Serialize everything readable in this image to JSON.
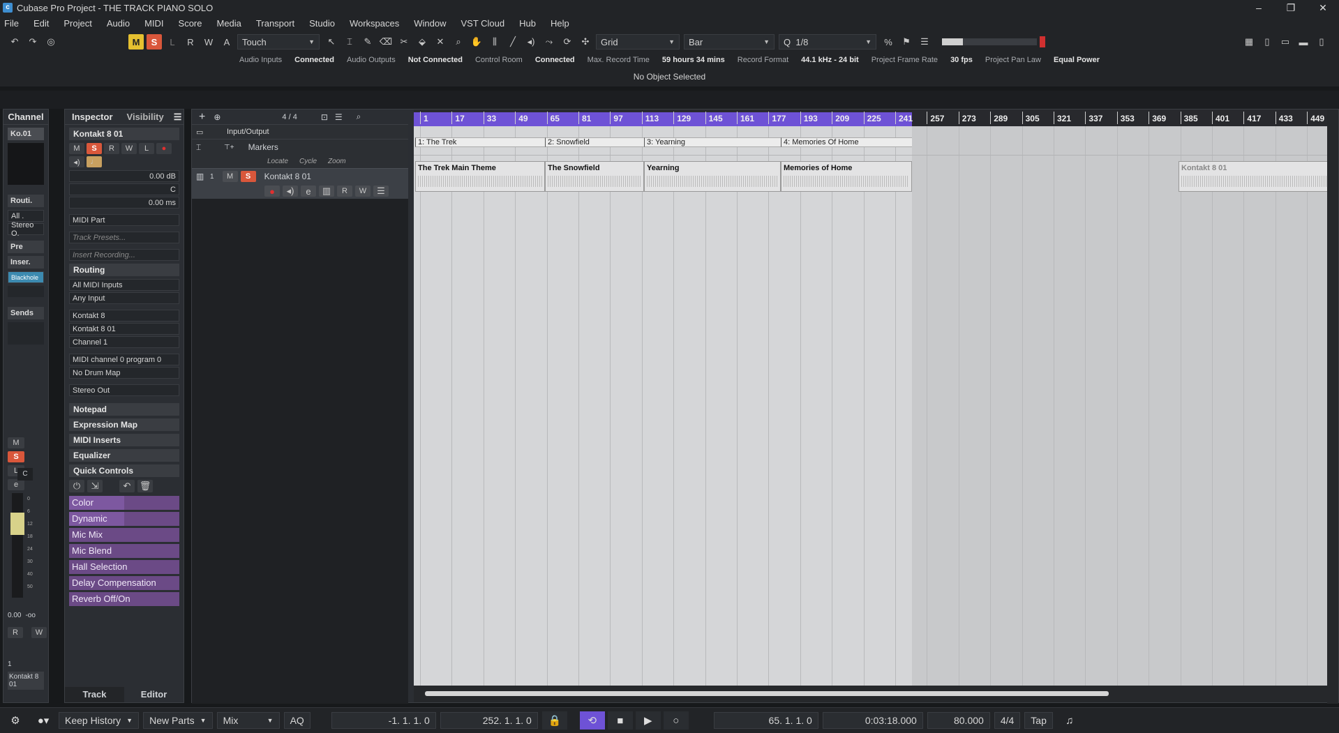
{
  "window": {
    "title": "Cubase Pro Project - THE TRACK PIANO SOLO",
    "controls": [
      "–",
      "❐",
      "✕"
    ]
  },
  "menu": [
    "File",
    "Edit",
    "Project",
    "Audio",
    "MIDI",
    "Score",
    "Media",
    "Transport",
    "Studio",
    "Workspaces",
    "Window",
    "VST Cloud",
    "Hub",
    "Help"
  ],
  "toolbar": {
    "mute_label": "M",
    "solo_label": "S",
    "listen_label": "L",
    "read_label": "R",
    "write_label": "W",
    "a_label": "A",
    "automation_mode": "Touch",
    "snap_type": "Grid",
    "grid_type": "Bar",
    "quantize": "1/8"
  },
  "statusline": [
    {
      "label": "Audio Inputs",
      "value": "Connected"
    },
    {
      "label": "Audio Outputs",
      "value": "Not Connected"
    },
    {
      "label": "Control Room",
      "value": "Connected"
    },
    {
      "label": "Max. Record Time",
      "value": "59 hours 34 mins"
    },
    {
      "label": "Record Format",
      "value": "44.1 kHz - 24 bit"
    },
    {
      "label": "Project Frame Rate",
      "value": "30 fps"
    },
    {
      "label": "Project Pan Law",
      "value": "Equal Power"
    }
  ],
  "infoline": "No Object Selected",
  "channel": {
    "header": "Channel",
    "name": "Ko.01",
    "routing": "Routi.",
    "input": "All .",
    "output": "Stereo O.",
    "pre": "Pre",
    "inserts": "Inser.",
    "insert_slot": "Blackhole",
    "sends": "Sends",
    "m": "M",
    "s": "S",
    "l": "L",
    "pan": "C",
    "fader_scale": [
      "0",
      "6",
      "12",
      "18",
      "24",
      "30",
      "40",
      "50"
    ],
    "volume": "0.00",
    "peak": "-oo",
    "r": "R",
    "w": "W",
    "track_number": "1",
    "track_name": "Kontakt 8 01"
  },
  "inspector": {
    "tabs": [
      "Inspector",
      "Visibility"
    ],
    "track_name": "Kontakt 8 01",
    "volume": "0.00 dB",
    "pan": "C",
    "delay": "0.00 ms",
    "part_type": "MIDI Part",
    "track_presets": "Track Presets...",
    "insert_recording": "Insert Recording...",
    "routing_title": "Routing",
    "midi_input": "All MIDI Inputs",
    "any_input": "Any Input",
    "instrument": "Kontakt 8",
    "instrument_out": "Kontakt 8 01",
    "channel": "Channel 1",
    "program": "MIDI channel 0 program 0",
    "drum_map": "No Drum Map",
    "output": "Stereo Out",
    "sections": [
      "Notepad",
      "Expression Map",
      "MIDI Inserts",
      "Equalizer"
    ],
    "quick_controls_title": "Quick Controls",
    "quick_controls": [
      {
        "name": "Color",
        "fill": 0.5
      },
      {
        "name": "Dynamic",
        "fill": 0.5
      },
      {
        "name": "Mic Mix",
        "fill": 0
      },
      {
        "name": "Mic Blend",
        "fill": 0
      },
      {
        "name": "Hall Selection",
        "fill": 0
      },
      {
        "name": "Delay Compensation",
        "fill": 0
      },
      {
        "name": "Reverb Off/On",
        "fill": 0
      }
    ],
    "bottom_tabs": [
      "Track",
      "Editor"
    ]
  },
  "tracks": {
    "count": "4 / 4",
    "io_label": "Input/Output",
    "markers_label": "Markers",
    "locate": "Locate",
    "cycle": "Cycle",
    "zoom": "Zoom",
    "instrument_track_number": "1",
    "instrument_track_name": "Kontakt 8 01"
  },
  "ruler": [
    "1",
    "17",
    "33",
    "49",
    "65",
    "81",
    "97",
    "113",
    "129",
    "145",
    "161",
    "177",
    "193",
    "209",
    "225",
    "241",
    "257",
    "273",
    "289",
    "305",
    "321",
    "337",
    "353",
    "369",
    "385",
    "401",
    "417",
    "433",
    "449"
  ],
  "markers": [
    "1: The Trek",
    "2: Snowfield",
    "3: Yearning",
    "4: Memories Of Home"
  ],
  "parts": [
    "The Trek Main Theme",
    "The Snowfield",
    "Yearning",
    "Memories of Home",
    "Kontakt 8 01"
  ],
  "transport": {
    "keep_history": "Keep History",
    "new_parts": "New Parts",
    "mix": "Mix",
    "aq": "AQ",
    "left_locator": "-1. 1. 1.   0",
    "right_locator": "252. 1. 1.   0",
    "position": "65. 1. 1.   0",
    "time": "0:03:18.000",
    "tempo": "80.000",
    "signature": "4/4",
    "tap": "Tap"
  }
}
